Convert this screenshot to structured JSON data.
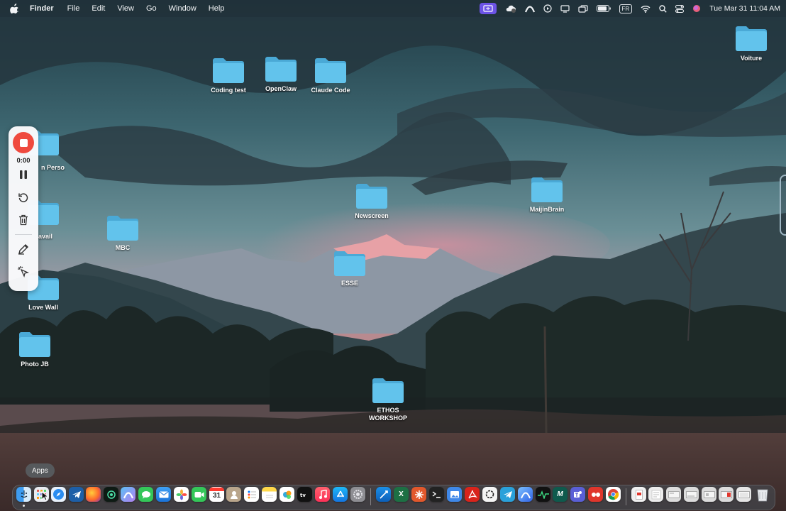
{
  "menubar": {
    "app_name": "Finder",
    "menus": [
      "File",
      "Edit",
      "View",
      "Go",
      "Window",
      "Help"
    ],
    "input_source": "FR",
    "clock": "Tue Mar 31  11:04 AM"
  },
  "desktop": {
    "folders": {
      "coding_test": "Coding test",
      "openclaw": "OpenClaw",
      "claude_code": "Claude Code",
      "voiture": "Voiture",
      "perso": "n Perso",
      "travail": "avail",
      "mbc": "MBC",
      "newscreen": "Newscreen",
      "maijinbrain": "MaijinBrain",
      "esse": "ESSE",
      "love_wall": "Love Wall",
      "photo_jb": "Photo JB",
      "ethos_workshop": "ETHOS WORKSHOP"
    },
    "folder_color": "#5cc2ea"
  },
  "recorder": {
    "elapsed": "0:00",
    "accent": "#ef4a3f"
  },
  "tooltip": {
    "text": "Apps"
  },
  "dock": {
    "calendar_day": "31"
  }
}
